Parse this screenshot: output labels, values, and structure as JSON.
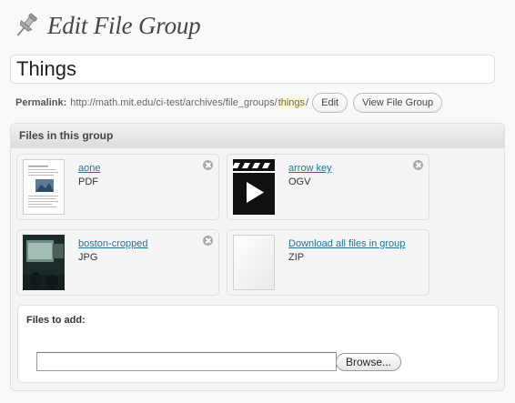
{
  "header": {
    "title": "Edit File Group",
    "icon": "pushpin-icon"
  },
  "title_field": {
    "value": "Things"
  },
  "permalink": {
    "label": "Permalink:",
    "url_prefix": "http://math.mit.edu/ci-test/archives/file_groups/",
    "slug": "things",
    "url_suffix": "/",
    "edit_label": "Edit",
    "view_label": "View File Group"
  },
  "files_box": {
    "title": "Files in this group",
    "files": [
      {
        "name": "aone",
        "type": "PDF",
        "thumb": "pdf-document-thumbnail",
        "removable": true
      },
      {
        "name": "arrow key",
        "type": "OGV",
        "thumb": "video-clapper-thumbnail",
        "removable": true
      },
      {
        "name": "boston-cropped",
        "type": "JPG",
        "thumb": "photo-thumbnail",
        "removable": true
      },
      {
        "name": "Download all files in group",
        "type": "ZIP",
        "thumb": "zip-document-thumbnail",
        "removable": false
      }
    ]
  },
  "files_to_add": {
    "label": "Files to add:",
    "browse_label": "Browse..."
  },
  "colors": {
    "link": "#21759b",
    "slug_highlight": "#fffbcc",
    "title_text": "#464646"
  }
}
